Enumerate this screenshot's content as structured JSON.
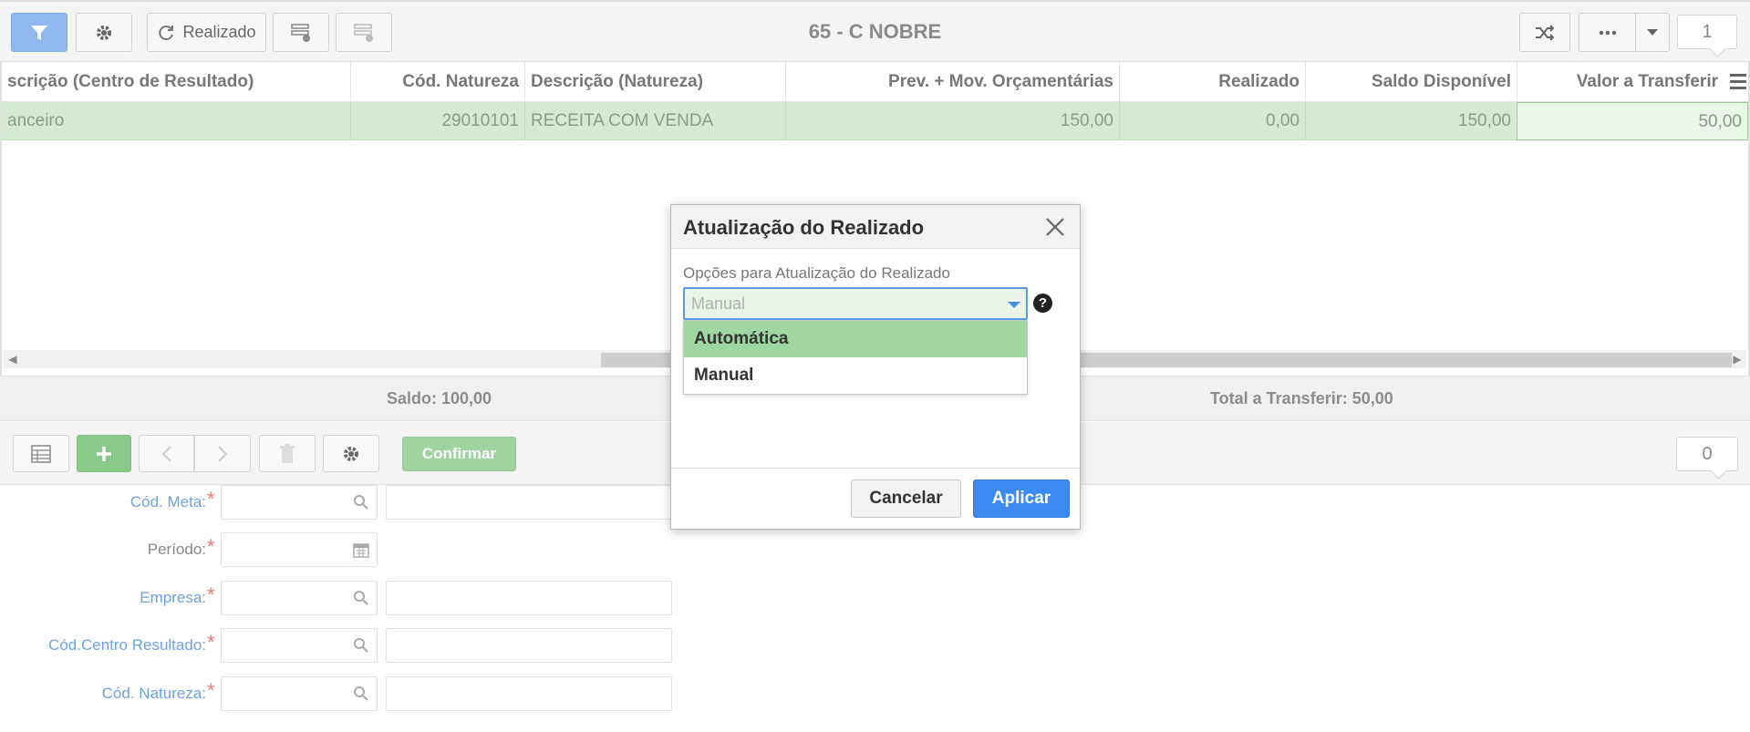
{
  "toolbar": {
    "title": "65 - C NOBRE",
    "realizado_label": "Realizado",
    "record_counter": "1"
  },
  "grid": {
    "columns": [
      "scrição (Centro de Resultado)",
      "Cód. Natureza",
      "Descrição (Natureza)",
      "Prev. + Mov. Orçamentárias",
      "Realizado",
      "Saldo Disponível",
      "Valor a Transferir"
    ],
    "rows": [
      {
        "centro_resultado": "anceiro",
        "cod_natureza": "29010101",
        "descricao_natureza": "RECEITA COM VENDA",
        "prev_mov": "150,00",
        "realizado": "0,00",
        "saldo_disponivel": "150,00",
        "valor_transferir": "50,00"
      }
    ]
  },
  "totals": {
    "saldo": "Saldo: 100,00",
    "total_transferir": "Total a Transferir: 50,00"
  },
  "form_toolbar": {
    "confirm_label": "Confirmar",
    "record_counter": "0"
  },
  "form": {
    "fields": [
      {
        "label": "Cód. Meta:"
      },
      {
        "label": "Período:"
      },
      {
        "label": "Empresa:"
      },
      {
        "label": "Cód.Centro Resultado:"
      },
      {
        "label": "Cód. Natureza:"
      }
    ]
  },
  "modal": {
    "title": "Atualização do Realizado",
    "field_label": "Opções para Atualização do Realizado",
    "selected_value": "Manual",
    "help_symbol": "?",
    "options": [
      "Automática",
      "Manual"
    ],
    "cancel_label": "Cancelar",
    "apply_label": "Aplicar"
  },
  "colors": {
    "row_selected": "#d4ead3",
    "filter_active": "#8fb8ee",
    "apply_button": "#3d8bf0",
    "option_highlight": "#9fd6a2",
    "field_label": "#6fa2dd"
  },
  "icons": [
    "filter-icon",
    "gear-icon",
    "refresh-icon",
    "form-view-icon",
    "grid-view-icon",
    "shuffle-icon",
    "more-icon",
    "chevron-down-icon",
    "grid-icon",
    "plus-icon",
    "chevron-left-icon",
    "chevron-right-icon",
    "trash-icon",
    "search-icon",
    "calendar-icon",
    "close-icon",
    "help-icon",
    "menu-icon"
  ]
}
